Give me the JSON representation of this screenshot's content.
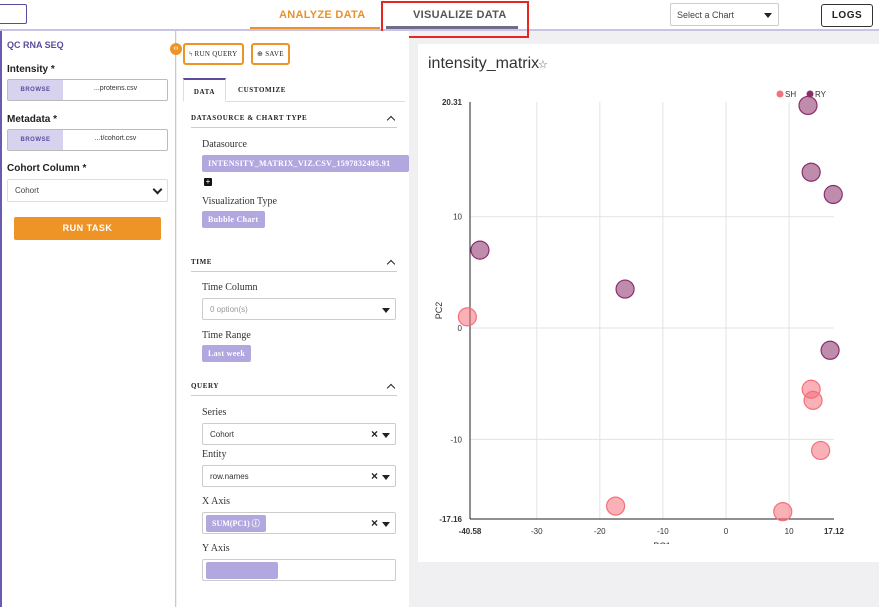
{
  "nav": {
    "analyze_label": "ANALYZE DATA",
    "visualize_label": "VISUALIZE DATA",
    "chart_select_value": "Select a Chart",
    "logs_label": "LOGS"
  },
  "left": {
    "title": "QC RNA SEQ",
    "intensity_label": "Intensity *",
    "intensity_browse": "BROWSE",
    "intensity_file": "...proteins.csv",
    "metadata_label": "Metadata *",
    "metadata_browse": "BROWSE",
    "metadata_file": "...t/cohort.csv",
    "cohort_label": "Cohort Column *",
    "cohort_value": "Cohort",
    "run_task_label": "RUN TASK"
  },
  "mid": {
    "run_query_label": "RUN QUERY",
    "save_label": "SAVE",
    "tab_data": "DATA",
    "tab_customize": "CUSTOMIZE",
    "sec_datasource": "DATASOURCE & CHART TYPE",
    "datasource_label": "Datasource",
    "datasource_value": "INTENSITY_MATRIX_VIZ.CSV_1597832405.91",
    "vis_type_label": "Visualization Type",
    "vis_type_value": "Bubble Chart",
    "sec_time": "TIME",
    "time_column_label": "Time Column",
    "time_column_placeholder": "0 option(s)",
    "time_range_label": "Time Range",
    "time_range_value": "Last week",
    "sec_query": "QUERY",
    "series_label": "Series",
    "series_value": "Cohort",
    "entity_label": "Entity",
    "entity_value": "row.names",
    "xaxis_label": "X Axis",
    "xaxis_value": "SUM(PC1)",
    "yaxis_label": "Y Axis"
  },
  "chart": {
    "title": "intensity_matrix"
  },
  "chart_data": {
    "type": "scatter",
    "title": "intensity_matrix",
    "xlabel": "PC1",
    "ylabel": "PC2",
    "xlim": [
      -40.58,
      17.12
    ],
    "ylim": [
      -17.16,
      20.31
    ],
    "x_ticks": [
      -40.58,
      -30,
      -20,
      -10,
      0,
      10,
      17.12
    ],
    "y_ticks": [
      -17.16,
      -10,
      0,
      10,
      20.31
    ],
    "grid": true,
    "legend_position": "top-right",
    "series": [
      {
        "name": "SH",
        "color": "#f4707a",
        "points": [
          [
            -41,
            1
          ],
          [
            -17.5,
            -16
          ],
          [
            9,
            -16.5
          ],
          [
            13.5,
            -5.5
          ],
          [
            13.8,
            -6.5
          ],
          [
            15,
            -11
          ]
        ]
      },
      {
        "name": "RY",
        "color": "#8a2e6b",
        "points": [
          [
            -39,
            7
          ],
          [
            -16,
            3.5
          ],
          [
            13,
            20
          ],
          [
            13.5,
            14
          ],
          [
            17,
            12
          ],
          [
            16.5,
            -2
          ]
        ]
      }
    ]
  }
}
